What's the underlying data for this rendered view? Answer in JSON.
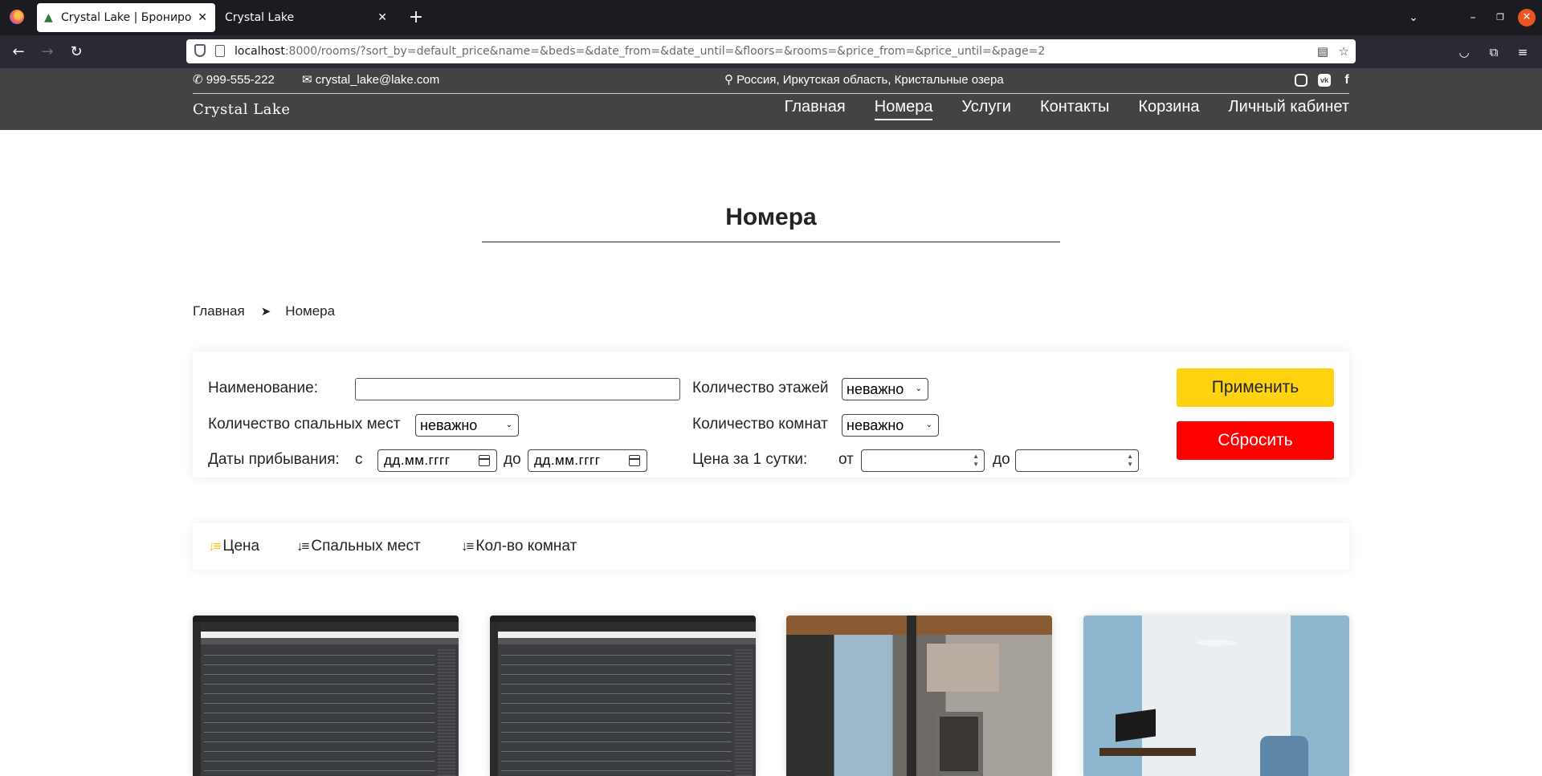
{
  "browser": {
    "tabs": [
      {
        "title": "Crystal Lake | Бронирование",
        "active": true
      },
      {
        "title": "Crystal Lake",
        "active": false
      }
    ],
    "url_host": "localhost",
    "url_rest": ":8000/rooms/?sort_by=default_price&name=&beds=&date_from=&date_until=&floors=&rooms=&price_from=&price_until=&page=2"
  },
  "header": {
    "phone": "999-555-222",
    "email": "crystal_lake@lake.com",
    "address": "Россия, Иркутская область, Кристальные озера",
    "brand": "Crystal Lake",
    "menu": [
      "Главная",
      "Номера",
      "Услуги",
      "Контакты",
      "Корзина",
      "Личный кабинет"
    ],
    "active_menu": "Номера"
  },
  "page": {
    "title": "Номера",
    "breadcrumb": {
      "home": "Главная",
      "separator": "➤",
      "current": "Номера"
    }
  },
  "filter": {
    "name_label": "Наименование:",
    "name_value": "",
    "floors_label": "Количество этажей",
    "floors_value": "неважно",
    "beds_label": "Количество спальных мест",
    "beds_value": "неважно",
    "rooms_label": "Количество комнат",
    "rooms_value": "неважно",
    "dates_label": "Даты прибывания:",
    "date_from_prefix": "с",
    "date_from_placeholder": "дд.мм.гггг",
    "date_until_prefix": "до",
    "date_until_placeholder": "дд.мм.гггг",
    "price_label": "Цена за 1 сутки:",
    "price_from_prefix": "от",
    "price_until_prefix": "до",
    "apply_label": "Применить",
    "reset_label": "Сбросить",
    "colors": {
      "apply": "#ffd30f",
      "reset": "#ff0000"
    }
  },
  "sort": {
    "items": [
      "Цена",
      "Спальных мест",
      "Кол-во комнат"
    ],
    "active": "Цена",
    "active_color": "#ffc107"
  },
  "rooms": [
    {
      "image": "code-screenshot-1"
    },
    {
      "image": "code-screenshot-2"
    },
    {
      "image": "modern-interior-fireplace"
    },
    {
      "image": "hotel-room-blue-curtains"
    }
  ]
}
